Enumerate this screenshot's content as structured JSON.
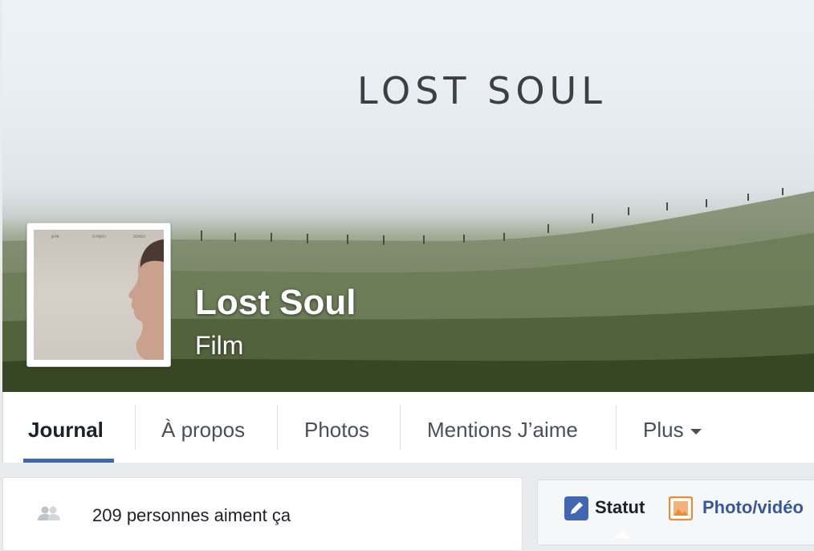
{
  "cover": {
    "title": "LOST SOUL"
  },
  "page": {
    "name": "Lost Soul",
    "category": "Film"
  },
  "poster": {
    "credits": [
      "JEAN",
      "D'ANJOU",
      "DONDO"
    ]
  },
  "tabs": [
    {
      "label": "Journal",
      "active": true
    },
    {
      "label": "À propos",
      "active": false
    },
    {
      "label": "Photos",
      "active": false
    },
    {
      "label": "Mentions J’aime",
      "active": false
    },
    {
      "label": "Plus",
      "active": false
    }
  ],
  "likes": {
    "text": "209 personnes aiment ça",
    "icon": "people-icon"
  },
  "composer": {
    "status_label": "Statut",
    "status_icon": "pencil-icon",
    "photo_label": "Photo/vidéo",
    "photo_icon": "photo-icon"
  },
  "colors": {
    "accent": "#4267b2",
    "link": "#365899",
    "background": "#e9ebee"
  }
}
